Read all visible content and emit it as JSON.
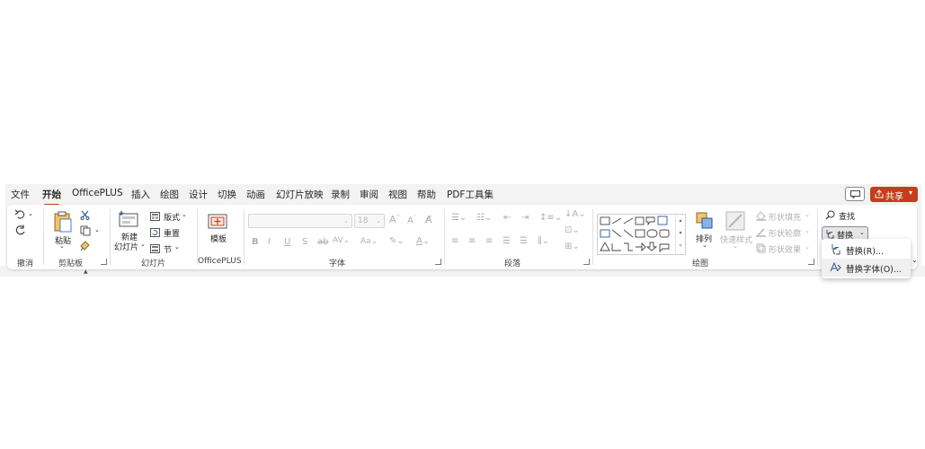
{
  "tabs": [
    "文件",
    "开始",
    "OfficePLUS",
    "插入",
    "绘图",
    "设计",
    "切换",
    "动画",
    "幻灯片放映",
    "录制",
    "审阅",
    "视图",
    "帮助",
    "PDF工具集"
  ],
  "active_tab": "开始",
  "share": {
    "label": "共享",
    "color": "#c43e1c"
  },
  "groups": {
    "undo": {
      "label": "撤消"
    },
    "clipboard": {
      "label": "剪贴板",
      "paste_label": "粘贴"
    },
    "slides": {
      "label": "幻灯片",
      "new_slide_line1": "新建",
      "new_slide_line2": "幻灯片",
      "layout": "版式",
      "reset": "重置",
      "section": "节"
    },
    "officeplus": {
      "label": "OfficePLUS",
      "template": "模板"
    },
    "font": {
      "label": "字体",
      "font_size": "18"
    },
    "paragraph": {
      "label": "段落"
    },
    "drawing": {
      "label": "绘图",
      "arrange": "排列",
      "quick_styles": "快速样式",
      "shape_fill": "形状填充",
      "shape_outline": "形状轮廓",
      "shape_effects": "形状效果"
    },
    "editing": {
      "find": "查找",
      "replace": "替换"
    }
  },
  "replace_menu": [
    {
      "label": "替换(R)..."
    },
    {
      "label": "替换字体(O)..."
    }
  ]
}
